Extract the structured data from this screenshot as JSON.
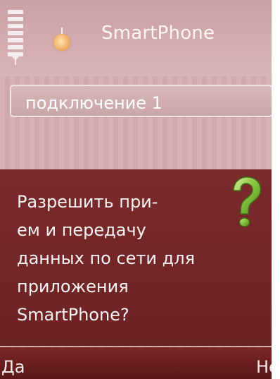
{
  "header": {
    "app_title": "SmartPhone",
    "signal_icon": "signal-strength-icon",
    "battery_icon": "battery-level-icon",
    "app_icon": "app-icon"
  },
  "list": {
    "items": [
      {
        "label": "подключение 1"
      }
    ]
  },
  "dialog": {
    "lines": [
      "Разрешить при-",
      "ем и передачу",
      "данных по сети для",
      "приложения",
      "SmartPhone?"
    ],
    "icon": "question-icon"
  },
  "softkeys": {
    "left": "Да",
    "right": "Нет"
  },
  "colors": {
    "background": "#d8b1b2",
    "dialog": "#7b2a2b",
    "softkey_bar": "#6a1f20",
    "question_icon": "#8bc53f",
    "text": "#ffffff"
  }
}
